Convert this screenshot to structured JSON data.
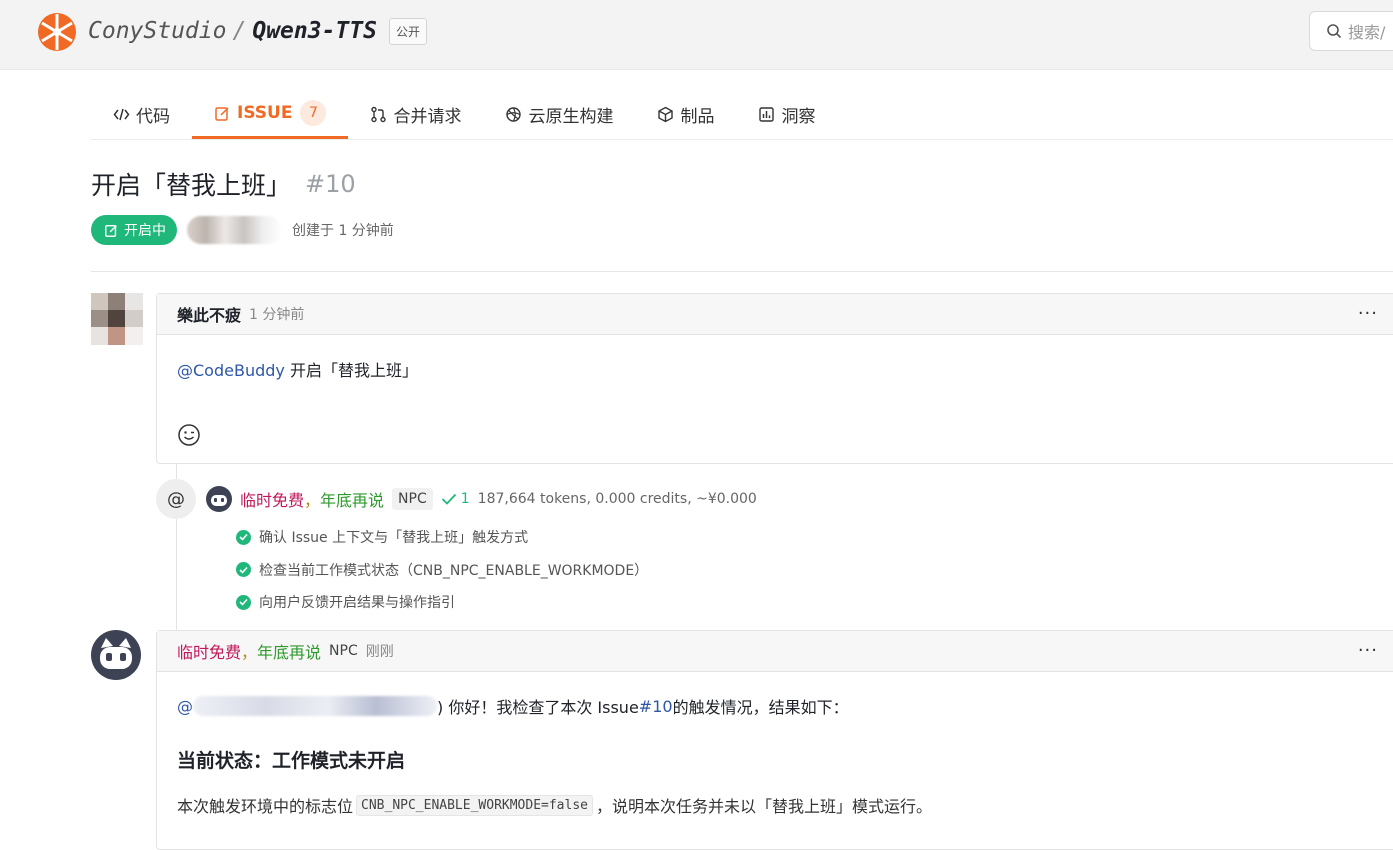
{
  "header": {
    "org": "ConyStudio",
    "separator": "/",
    "repo": "Qwen3-TTS",
    "visibility": "公开",
    "search_placeholder": "搜索/",
    "brand_color": "#f06a25"
  },
  "tabs": [
    {
      "label": "代码",
      "icon": "code-icon"
    },
    {
      "label": "ISSUE",
      "icon": "issue-edit-icon",
      "count": "7",
      "active": true
    },
    {
      "label": "合并请求",
      "icon": "merge-request-icon"
    },
    {
      "label": "云原生构建",
      "icon": "build-icon"
    },
    {
      "label": "制品",
      "icon": "package-icon"
    },
    {
      "label": "洞察",
      "icon": "insights-icon"
    }
  ],
  "issue": {
    "title": "开启「替我上班」",
    "number": "#10",
    "status": "开启中",
    "created": "创建于 1 分钟前",
    "status_color": "#1fb87a"
  },
  "comment1": {
    "author": "樂此不疲",
    "time": "1 分钟前",
    "mention": "@CodeBuddy",
    "text": " 开启「替我上班」"
  },
  "activity": {
    "name_part1": "临时免费",
    "name_part2": "，",
    "name_part3": "年底再说",
    "tag": "NPC",
    "check_count": "1",
    "usage": "187,664 tokens, 0.000 credits, ~¥0.000",
    "steps": [
      "确认 Issue 上下文与「替我上班」触发方式",
      "检查当前工作模式状态（CNB_NPC_ENABLE_WORKMODE）",
      "向用户反馈开启结果与操作指引"
    ]
  },
  "comment2": {
    "name_part1": "临时免费",
    "name_part2": "，",
    "name_part3": "年底再说",
    "tag": "NPC",
    "time": "刚刚",
    "intro_prefix": "@",
    "intro_suffix": ") 你好！我检查了本次 Issue ",
    "intro_issue": "#10",
    "intro_end": " 的触发情况，结果如下：",
    "heading": "当前状态：工作模式未开启",
    "para_prefix": "本次触发环境中的标志位",
    "para_code": "CNB_NPC_ENABLE_WORKMODE=false",
    "para_suffix": "，说明本次任务并未以「替我上班」模式运行。"
  }
}
